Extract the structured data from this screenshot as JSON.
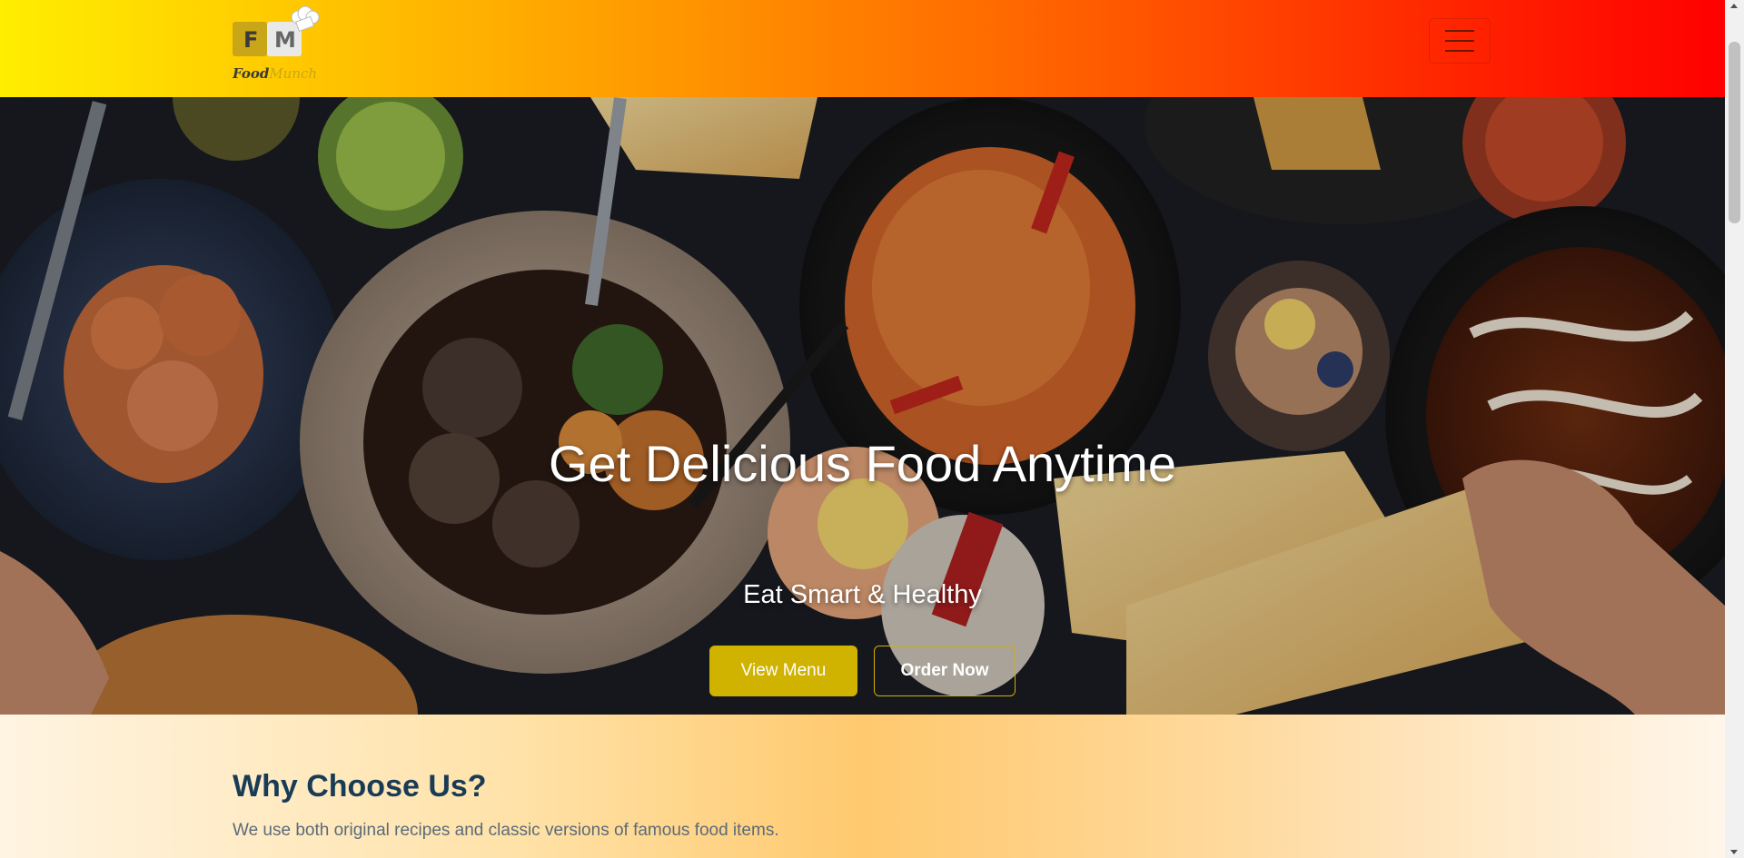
{
  "navbar": {
    "logo": {
      "letters": [
        "F",
        "M"
      ],
      "text_part1": "Food",
      "text_part2": "Munch",
      "icon": "chef-hat-icon"
    },
    "toggler_icon": "hamburger-menu-icon",
    "gradient_colors": [
      "#ffee00",
      "#ff0000"
    ]
  },
  "hero": {
    "title": "Get Delicious Food Anytime",
    "subtitle": "Eat Smart & Healthy",
    "buttons": {
      "view_menu": "View Menu",
      "order_now": "Order Now"
    }
  },
  "why_section": {
    "title": "Why Choose Us?",
    "description": "We use both original recipes and classic versions of famous food items."
  },
  "colors": {
    "accent": "#d0b200",
    "heading": "#183b56",
    "body_text": "#5a6b7b"
  }
}
